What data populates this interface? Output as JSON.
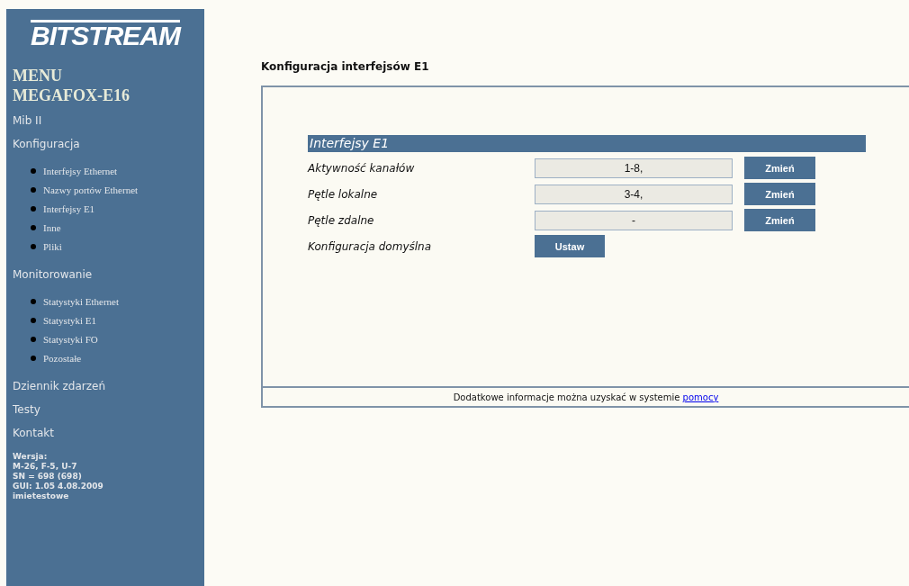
{
  "sidebar": {
    "logo": "BITSTREAM",
    "title_lines": [
      "MENU",
      "MEGAFOX-E16"
    ],
    "sections": [
      {
        "label": "Mib II"
      },
      {
        "label": "Konfiguracja",
        "items": [
          "Interfejsy Ethernet",
          "Nazwy portów Ethernet",
          "Interfejsy E1",
          "Inne",
          "Pliki"
        ]
      },
      {
        "label": "Monitorowanie",
        "items": [
          "Statystyki Ethernet",
          "Statystyki E1",
          "Statystyki FO",
          "Pozostałe"
        ]
      },
      {
        "label": "Dziennik zdarzeń"
      },
      {
        "label": "Testy"
      },
      {
        "label": "Kontakt"
      }
    ],
    "version_lines": [
      "Wersja:",
      "M-26, F-5, U-7",
      "SN = 698 (698)",
      "GUI: 1.05 4.08.2009",
      "imietestowe"
    ]
  },
  "page_title": "Konfiguracja interfejsów E1",
  "panel": {
    "heading": "Interfejsy E1",
    "rows": [
      {
        "kind": "field",
        "label": "Aktywność kanałów",
        "value": "1-8,",
        "button": "Zmień"
      },
      {
        "kind": "field",
        "label": "Pętle lokalne",
        "value": "3-4,",
        "button": "Zmień"
      },
      {
        "kind": "field",
        "label": "Pętle zdalne",
        "value": "-",
        "button": "Zmień"
      },
      {
        "kind": "action",
        "label": "Konfiguracja domyślna",
        "button": "Ustaw"
      }
    ]
  },
  "footer": {
    "text": "Dodatkowe informacje można uzyskać w systemie",
    "link": "pomocy"
  }
}
